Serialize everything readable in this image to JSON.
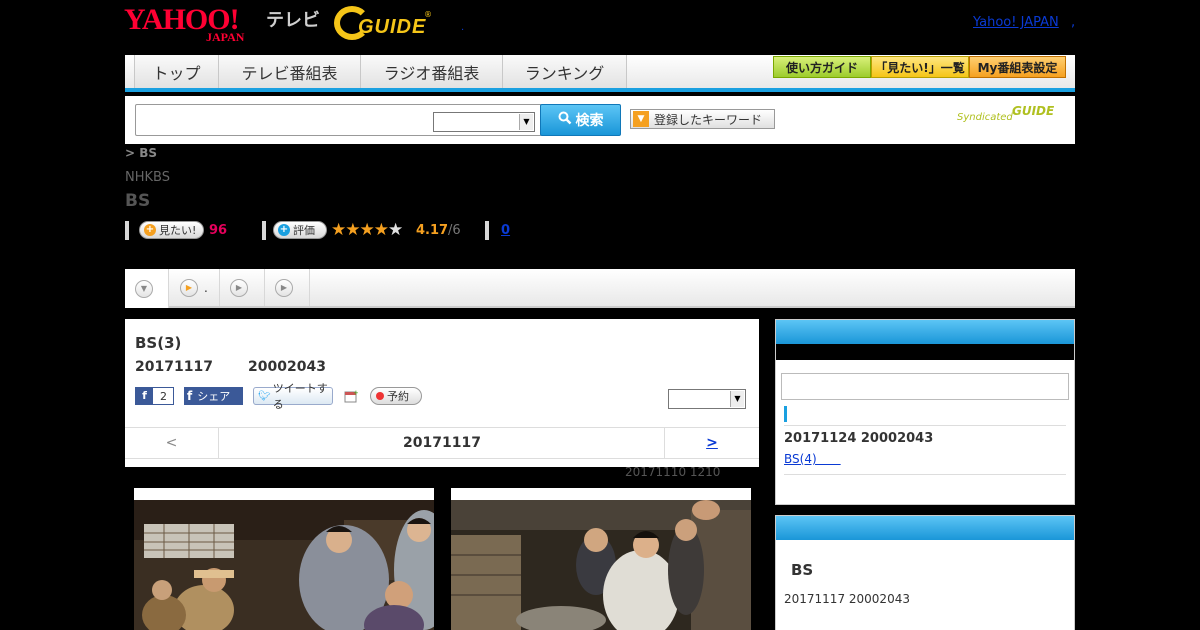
{
  "header": {
    "yahoo_logo": "YAHOO!",
    "yahoo_logo_sub": "JAPAN",
    "tv_label": "テレビ",
    "gguide_logo": "GUIDE",
    "gguide_reg": "®",
    "dot": ".",
    "yahoo_japan_link": "Yahoo! JAPAN",
    "comma": ","
  },
  "nav": {
    "tabs": [
      {
        "label": "トップ"
      },
      {
        "label": "テレビ番組表"
      },
      {
        "label": "ラジオ番組表"
      },
      {
        "label": "ランキング"
      }
    ],
    "guide_label": "使い方ガイド",
    "mitai_label": "「見たい!」一覧",
    "my_label": "My番組表設定"
  },
  "search": {
    "placeholder": "",
    "button_label": "検索",
    "keyword_label": "登録したキーワード",
    "syndicated_text": "Syndicated",
    "syndicated_logo": "GUIDE"
  },
  "program": {
    "breadcrumb": "> BS",
    "channel": "NHKBS",
    "title": "BS"
  },
  "stats": {
    "mitai_label": "見たい!",
    "mitai_count": "96",
    "rating_label": "評価",
    "stars_filled": 4,
    "stars_total": 5,
    "rating_value": "4.17",
    "rating_count": "/6",
    "review_count": "0"
  },
  "subtabs": {
    "tab1_label": "."
  },
  "episode": {
    "title": "BS(3)",
    "date": "20171117",
    "time": "20002043",
    "fb_like_count": "2",
    "fb_share_label": "シェア",
    "tweet_label": "ツイートする",
    "reserve_label": "予約",
    "pager_prev": "<",
    "pager_date": "20171117",
    "pager_next": ">",
    "prev_broadcast": "20171110  1210"
  },
  "sidebar": {
    "next_info": "20171124  20002043",
    "next_link": "BS(4)　　",
    "box2_title": "BS",
    "box2_date": "20171117  20002043"
  },
  "colors": {
    "accent_blue": "#1aa0e0",
    "star_orange": "#f5a020",
    "count_pink": "#e6005c",
    "link_blue": "#0a3ad4"
  }
}
